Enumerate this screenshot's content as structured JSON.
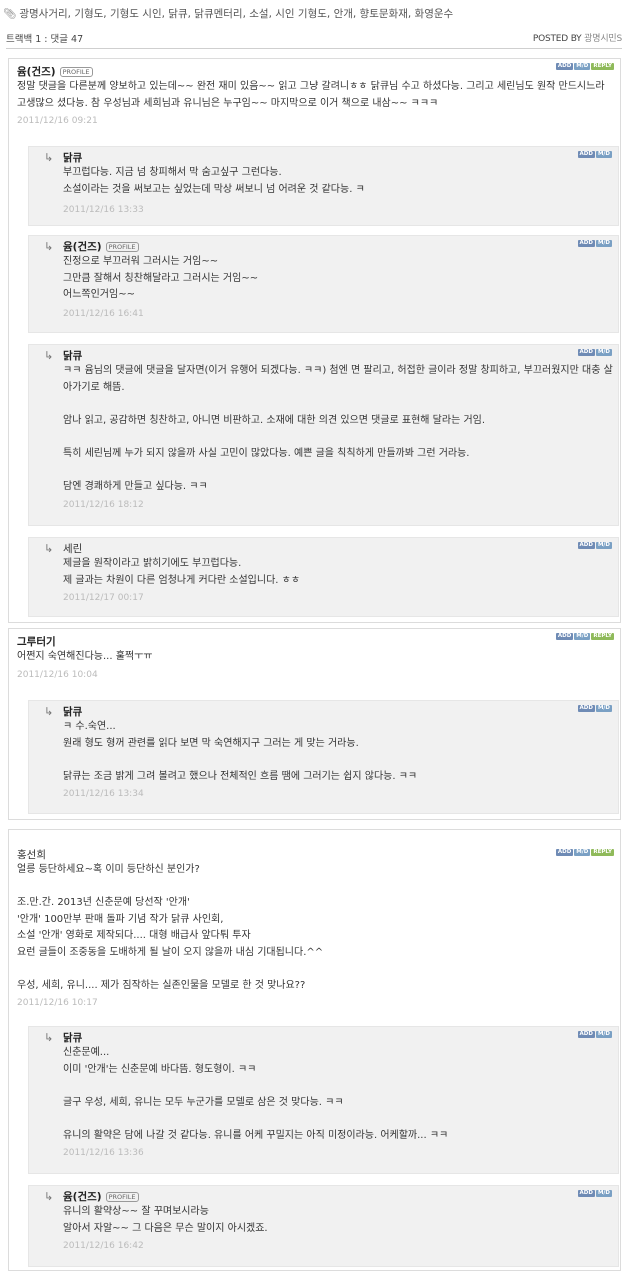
{
  "tags": {
    "clip_icon": "paperclip-icon",
    "text": "광명사거리, 기형도, 기형도 시인, 닭큐, 닭큐멘터리, 소설, 시인 기형도, 안개, 향토문화재, 화영운수"
  },
  "trackbar": {
    "left": "트랙백 1 : 댓글 47",
    "posted_by": "POSTED BY",
    "author": "광명시민S"
  },
  "buttons": {
    "add": "ADD",
    "md": "M/D",
    "reply": "REPLY"
  },
  "profile_badge": "PROFILE",
  "threads": [
    {
      "author": "윰(건즈)",
      "profile": true,
      "text": "정말 댓글을 다른분께 양보하고 있는데~~ 완전 재미 있음~~ 읽고 그냥 갈려니ㅎㅎ 닭큐님 수고 하셨다능. 그리고 세린님도 원작 만드시느라 고생많으 셨다능. 참 우성님과 세희님과 유니님은 누구임~~ 마지막으로 이거 책으로 내삼~~ ㅋㅋㅋ",
      "date": "2011/12/16 09:21",
      "replies": [
        {
          "author": "닭큐",
          "profile": false,
          "bold": true,
          "text": "부끄럽다능. 지금 넘 창피해서 막 숨고싶구 그런다능.\n소설이라는 것을 써보고는 싶었는데 막상 써보니 넘 어려운 것 같다능. ㅋ",
          "date": "2011/12/16 13:33"
        },
        {
          "author": "윰(건즈)",
          "profile": true,
          "bold": true,
          "text": "진정으로 부끄러워 그러시는 거임~~\n그만큼 잘해서 칭찬해달라고 그러시는 거임~~\n어느쪽인거임~~",
          "date": "2011/12/16 16:41"
        },
        {
          "author": "닭큐",
          "profile": false,
          "bold": true,
          "text": "ㅋㅋ 윰님의 댓글에 댓글을 달자면(이거 유행어 되겠다능. ㅋㅋ) 첨엔 면 팔리고, 허접한 글이라 정말 창피하고, 부끄러웠지만 대충 살아가기로 해뜸.\n\n암나 읽고, 공감하면 칭찬하고, 아니면 비판하고. 소재에 대한 의견 있으면 댓글로 표현해 달라는 거임.\n\n특히 세린님께 누가 되지 않을까 사실 고민이 많았다능. 예쁜 글을 칙칙하게 만들까봐 그런 거라능.\n\n담엔 경쾌하게 만들고 싶다능. ㅋㅋ",
          "date": "2011/12/16 18:12"
        },
        {
          "author": "세린",
          "profile": false,
          "bold": false,
          "text": "제글을 원작이라고 밝히기에도 부끄럽다능.\n제 글과는 차원이 다른 엄청나게 커다란 소설입니다. ㅎㅎ",
          "date": "2011/12/17 00:17"
        }
      ]
    },
    {
      "author": "그루터기",
      "profile": false,
      "text": "어쩐지 숙연해진다능... 훌쩍ㅜㅠ",
      "date": "2011/12/16 10:04",
      "replies": [
        {
          "author": "닭큐",
          "profile": false,
          "bold": true,
          "text": "ㅋ 수.숙연...\n원래 형도 형꺼 관련를 읽다 보면 막 숙연해지구 그러는 게 맞는 거라능.\n\n닭큐는 조금 밝게 그려 볼려고 했으나 전체적인 흐름 땜에 그러기는 쉽지 않다능. ㅋㅋ",
          "date": "2011/12/16 13:34"
        }
      ]
    },
    {
      "author": "홍선희",
      "profile": false,
      "plain": true,
      "text": "얼릉 등단하세요~혹 이미 등단하신 분인가?\n\n조.만.간. 2013년 신춘문예 당선작 '안개'\n'안개' 100만부 판매 돌파 기념 작가 닭큐 사인회,\n소설 '안개' 영화로 제작되다.... 대형 배급사 앞다퉈 투자\n요런 글들이 조중동을 도배하게 될 날이 오지 않을까 내심 기대됩니다.^^\n\n우성, 세희, 유니.... 제가 짐작하는 실존인물을 모델로 한 것 맞나요??",
      "date": "2011/12/16 10:17",
      "replies": [
        {
          "author": "닭큐",
          "profile": false,
          "bold": true,
          "text": "신춘문예...\n이미 '안개'는 신춘문예 바다뜸. 형도형이. ㅋㅋ\n\n글구 우성, 세희, 유니는 모두 누군가를 모델로 삼은 것 맞다능. ㅋㅋ\n\n유니의 활약은 담에 나갈 것 같다능. 유니를 어케 꾸밀지는 아직 미정이라능. 어케할까... ㅋㅋ",
          "date": "2011/12/16 13:36"
        },
        {
          "author": "윰(건즈)",
          "profile": true,
          "bold": true,
          "text": "유니의 활약상~~ 잘 꾸며보시라능\n알아서 자알~~ 그 다음은 무슨 말이지 아시겠죠.",
          "date": "2011/12/16 16:42"
        }
      ]
    }
  ]
}
